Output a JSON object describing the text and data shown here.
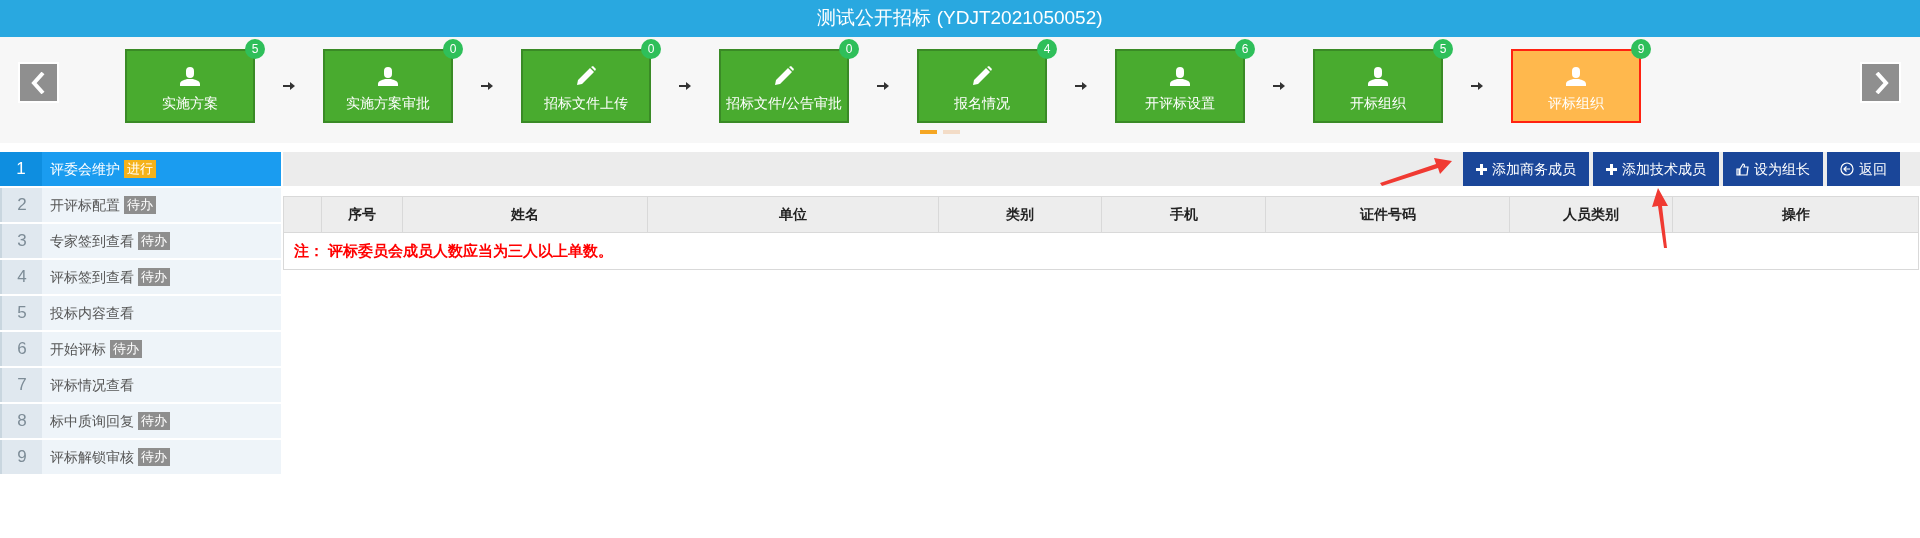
{
  "window": {
    "title": "测试公开招标 (YDJT2021050052)"
  },
  "steps": [
    {
      "label": "实施方案",
      "count": "5",
      "kind": "person",
      "selected": false
    },
    {
      "label": "实施方案审批",
      "count": "0",
      "kind": "person",
      "selected": false
    },
    {
      "label": "招标文件上传",
      "count": "0",
      "kind": "pencil",
      "selected": false
    },
    {
      "label": "招标文件/公告审批",
      "count": "0",
      "kind": "pencil",
      "selected": false
    },
    {
      "label": "报名情况",
      "count": "4",
      "kind": "pencil",
      "selected": false
    },
    {
      "label": "开评标设置",
      "count": "6",
      "kind": "person",
      "selected": false
    },
    {
      "label": "开标组织",
      "count": "5",
      "kind": "person",
      "selected": false
    },
    {
      "label": "评标组织",
      "count": "9",
      "kind": "person",
      "selected": true
    }
  ],
  "pager": [
    {
      "selected": true
    },
    {
      "selected": false
    }
  ],
  "sidebar": {
    "items": [
      {
        "number": "1",
        "label": "评委会维护",
        "status": {
          "kind": "active",
          "text": "进行"
        },
        "selected": true
      },
      {
        "number": "2",
        "label": "开评标配置",
        "status": {
          "kind": "todo",
          "text": "待办"
        },
        "selected": false
      },
      {
        "number": "3",
        "label": "专家签到查看",
        "status": {
          "kind": "todo",
          "text": "待办"
        },
        "selected": false
      },
      {
        "number": "4",
        "label": "评标签到查看",
        "status": {
          "kind": "todo",
          "text": "待办"
        },
        "selected": false
      },
      {
        "number": "5",
        "label": "投标内容查看",
        "selected": false
      },
      {
        "number": "6",
        "label": "开始评标",
        "status": {
          "kind": "todo",
          "text": "待办"
        },
        "selected": false
      },
      {
        "number": "7",
        "label": "评标情况查看",
        "selected": false
      },
      {
        "number": "8",
        "label": "标中质询回复",
        "status": {
          "kind": "todo",
          "text": "待办"
        },
        "selected": false
      },
      {
        "number": "9",
        "label": "评标解锁审核",
        "status": {
          "kind": "todo",
          "text": "待办"
        },
        "selected": false
      }
    ]
  },
  "toolbar": {
    "buttons": [
      {
        "label": "添加商务成员",
        "kind": "add"
      },
      {
        "label": "添加技术成员",
        "kind": "add"
      },
      {
        "label": "设为组长",
        "kind": "promote"
      },
      {
        "label": "返回",
        "kind": "back"
      }
    ]
  },
  "table": {
    "columns": [
      "",
      "序号",
      "姓名",
      "单位",
      "类别",
      "手机",
      "证件号码",
      "人员类别",
      "操作"
    ],
    "note": "注： 评标委员会成员人数应当为三人以上单数。"
  }
}
